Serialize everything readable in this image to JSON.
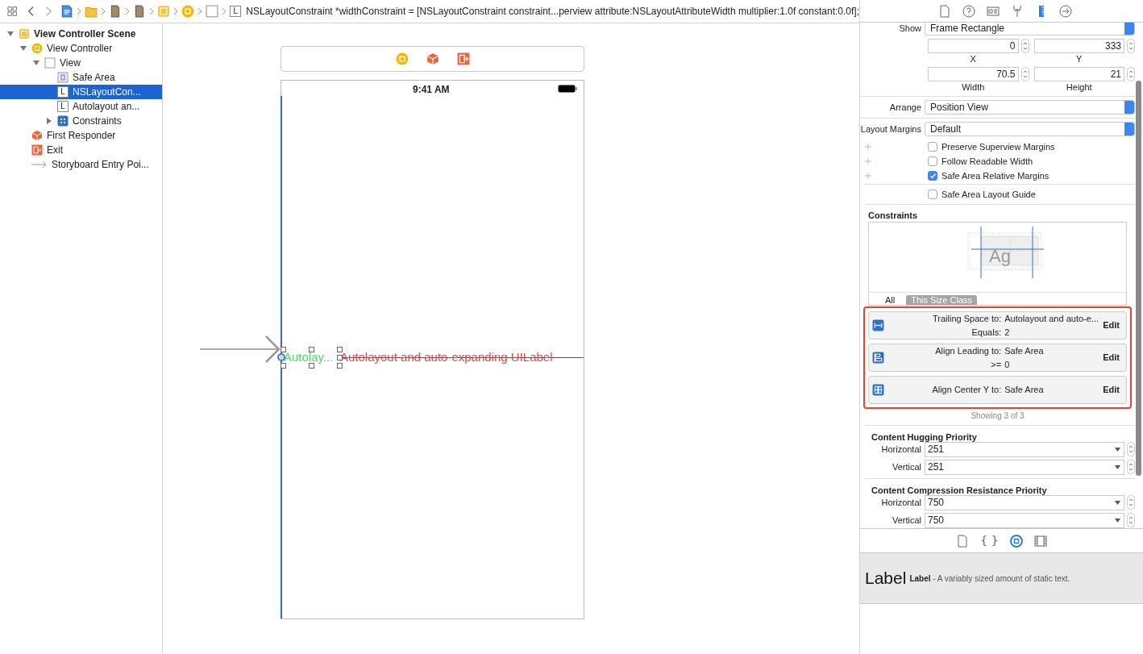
{
  "jump_bar": {
    "crumbs": [
      {
        "kind": "file"
      },
      {
        "kind": "folder"
      },
      {
        "kind": "group"
      },
      {
        "kind": "group"
      },
      {
        "kind": "scene"
      },
      {
        "kind": "view-controller"
      },
      {
        "kind": "view"
      },
      {
        "kind": "label",
        "glyph": "L"
      }
    ],
    "code": "NSLayoutConstraint *widthConstraint = [NSLayoutConstraint constraint...perview attribute:NSLayoutAttributeWidth multiplier:1.0f constant:0.0f];"
  },
  "outline": [
    {
      "kind": "scene",
      "label": "View Controller Scene",
      "expanded": true,
      "selected": false,
      "children": [
        {
          "kind": "view-controller",
          "label": "View Controller",
          "expanded": true,
          "selected": false,
          "children": [
            {
              "kind": "view",
              "label": "View",
              "expanded": true,
              "selected": false,
              "children": [
                {
                  "kind": "safe-area",
                  "label": "Safe Area",
                  "selected": false
                },
                {
                  "kind": "label",
                  "glyph": "L",
                  "label": "NSLayoutCon...",
                  "selected": true
                },
                {
                  "kind": "label",
                  "glyph": "L",
                  "label": "Autolayout an...",
                  "selected": false
                },
                {
                  "kind": "constraints",
                  "label": "Constraints",
                  "expanded": false,
                  "selected": false
                }
              ]
            }
          ]
        },
        {
          "kind": "first-responder",
          "label": "First Responder",
          "selected": false
        },
        {
          "kind": "exit",
          "label": "Exit",
          "selected": false
        },
        {
          "kind": "entry-point",
          "label": "Storyboard Entry Poi...",
          "selected": false
        }
      ]
    }
  ],
  "canvas": {
    "status_time": "9:41 AM",
    "labels": [
      {
        "text": "Autolay...",
        "color": "#4cd964",
        "selected": true
      },
      {
        "text": "Autolayout and auto-expanding UILabel",
        "color": "#e0484a",
        "selected": false
      }
    ]
  },
  "inspector": {
    "tabs": [
      {
        "kind": "file",
        "selected": false
      },
      {
        "kind": "help",
        "selected": false
      },
      {
        "kind": "identity",
        "selected": false
      },
      {
        "kind": "attributes",
        "selected": false
      },
      {
        "kind": "size",
        "selected": true
      },
      {
        "kind": "connections",
        "selected": false
      }
    ],
    "show": {
      "label": "Show",
      "value": "Frame Rectangle"
    },
    "frame_fields": [
      {
        "value": "0",
        "label": "X"
      },
      {
        "value": "333",
        "label": "Y"
      },
      {
        "value": "70.5",
        "label": "Width"
      },
      {
        "value": "21",
        "label": "Height"
      }
    ],
    "arrange": {
      "label": "Arrange",
      "value": "Position View"
    },
    "layout_margins": {
      "label": "Layout Margins",
      "value": "Default"
    },
    "margin_options": [
      {
        "label": "Preserve Superview Margins",
        "checked": false,
        "plus": true
      },
      {
        "label": "Follow Readable Width",
        "checked": false,
        "plus": true
      },
      {
        "label": "Safe Area Relative Margins",
        "checked": true,
        "plus": true
      }
    ],
    "safe_area_guide": {
      "label": "Safe Area Layout Guide",
      "checked": false
    },
    "constraints": {
      "title": "Constraints",
      "preview_glyph": "Ag",
      "filters": [
        {
          "label": "All",
          "selected": false
        },
        {
          "label": "This Size Class",
          "selected": true
        }
      ],
      "highlighted": true,
      "items": [
        {
          "kind": "trailing",
          "line_1_label": "Trailing Space to:",
          "line_1_value": "Autolayout and auto-e...",
          "line_2_label": "Equals:",
          "line_2_value": "2",
          "action": "Edit"
        },
        {
          "kind": "leading",
          "line_1_label": "Align Leading to:",
          "line_1_value": "Safe Area",
          "line_2_label": ">=",
          "line_2_value": "0",
          "action": "Edit"
        },
        {
          "kind": "center-y",
          "line_1_label": "Align Center Y to:",
          "line_1_value": "Safe Area",
          "action": "Edit"
        }
      ],
      "count": "Showing 3 of 3"
    },
    "priority_sections": [
      {
        "title": "Content Hugging Priority",
        "rows": [
          {
            "label": "Horizontal",
            "value": "251"
          },
          {
            "label": "Vertical",
            "value": "251"
          }
        ]
      },
      {
        "title": "Content Compression Resistance Priority",
        "rows": [
          {
            "label": "Horizontal",
            "value": "750"
          },
          {
            "label": "Vertical",
            "value": "750"
          }
        ]
      }
    ]
  },
  "library": {
    "tabs": [
      {
        "kind": "file",
        "selected": false
      },
      {
        "kind": "braces",
        "glyph": "{ }",
        "selected": false
      },
      {
        "kind": "object",
        "selected": true
      },
      {
        "kind": "media",
        "selected": false
      }
    ],
    "items": [
      {
        "preview": "Label",
        "name": "Label",
        "description": " - A variably sized amount of static text."
      }
    ]
  }
}
